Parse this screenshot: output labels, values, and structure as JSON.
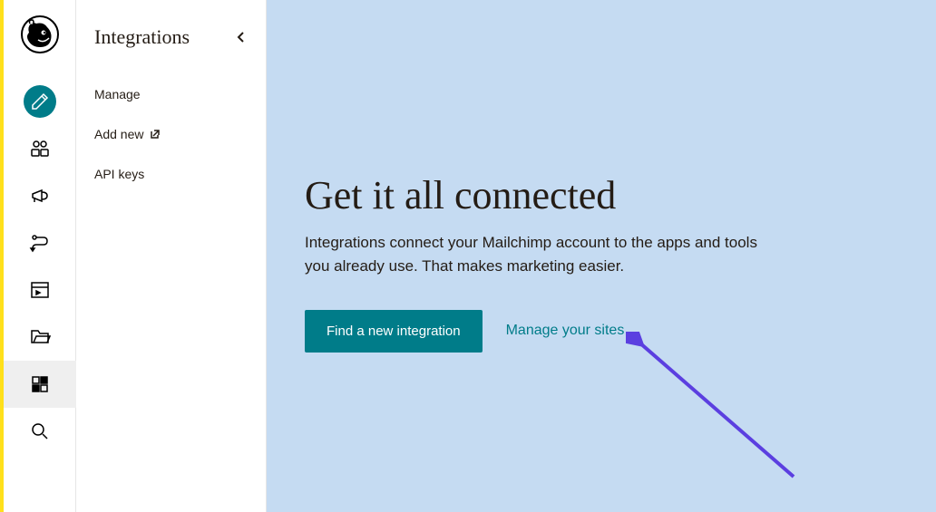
{
  "subnav": {
    "title": "Integrations",
    "items": [
      {
        "label": "Manage"
      },
      {
        "label": "Add new",
        "external": true
      },
      {
        "label": "API keys"
      }
    ]
  },
  "main": {
    "title": "Get it all connected",
    "description": "Integrations connect your Mailchimp account to the apps and tools you already use. That makes marketing easier.",
    "primary_button": "Find a new integration",
    "link_button": "Manage your sites"
  },
  "colors": {
    "accent": "#007c89",
    "highlight": "#ffe01b",
    "panel": "#c5dbf2"
  }
}
